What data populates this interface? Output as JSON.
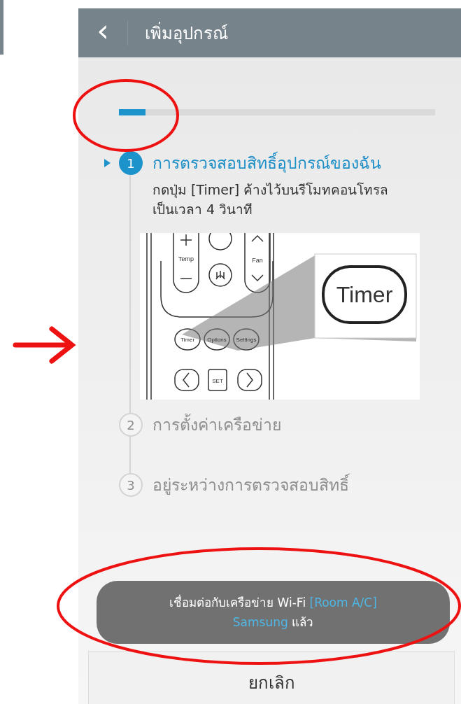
{
  "header": {
    "back_icon": "‹",
    "title": "เพิ่มอุปกรณ์"
  },
  "progress": {
    "level": 0.085
  },
  "steps": [
    {
      "number": "1",
      "title": "การตรวจสอบสิทธิ์อุปกรณ์ของฉัน",
      "selected": true,
      "description": "กดปุ่ม [Timer] ค้างไว้บนรีโมทคอนโทรล เป็นเวลา 4 วินาที"
    },
    {
      "number": "2",
      "title": "การตั้งค่าเครือข่าย",
      "selected": false
    },
    {
      "number": "3",
      "title": "อยู่ระหว่างการตรวจสอบสิทธิ์",
      "selected": false
    }
  ],
  "illustration": {
    "labels": [
      "Temp",
      "Fan"
    ],
    "buttons": [
      "Timer",
      "Options",
      "Settings"
    ],
    "keys": [
      "SET"
    ],
    "zoom_label": "Timer"
  },
  "toast": {
    "segments": [
      {
        "text": "เชื่อมต่อกับเครือข่าย Wi-Fi ",
        "highlight": false
      },
      {
        "text": "[Room A/C] Samsung",
        "highlight": true
      },
      {
        "text": " แล้ว",
        "highlight": false
      }
    ]
  },
  "cancel_button": "ยกเลิก",
  "annotations": [
    {
      "kind": "ellipse"
    },
    {
      "kind": "arrow"
    },
    {
      "kind": "ellipse"
    }
  ]
}
